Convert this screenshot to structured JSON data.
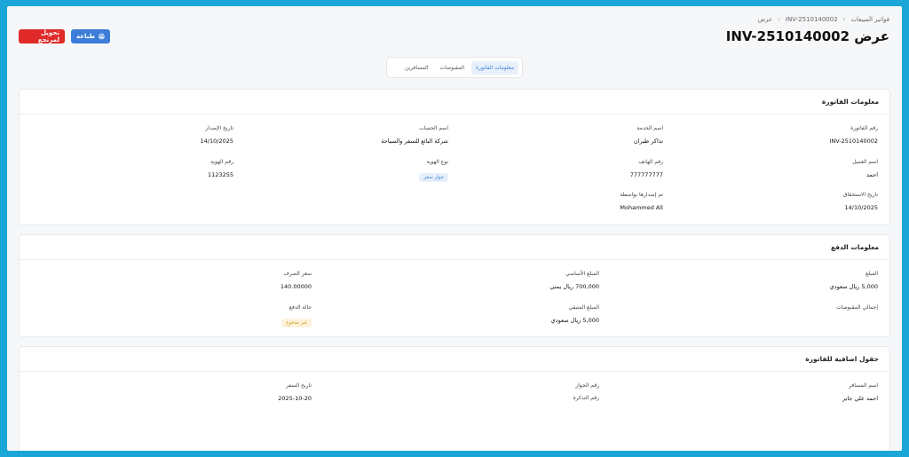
{
  "breadcrumb": {
    "items": [
      "فواتير المبيعات",
      "INV-2510140002",
      "عرض"
    ]
  },
  "page_title": "عرض INV-2510140002",
  "actions": {
    "print_label": "طباعة",
    "convert_label": "تحويل لمرتجع"
  },
  "tabs": [
    "معلومات الفاتورة",
    "المقبوضات",
    "المسافرين"
  ],
  "invoice_info": {
    "heading": "معلومات الفاتورة",
    "invoice_no_label": "رقم الفاتورة",
    "invoice_no": "INV-2510140002",
    "service_label": "اسم الخدمة",
    "service": "تذاكر طيران",
    "account_label": "اسم الحساب",
    "account": "شركة البائع للسفر والسياحة",
    "issue_date_label": "تاريخ الإصدار",
    "issue_date": "14/10/2025",
    "customer_label": "اسم العميل",
    "customer": "احمد",
    "phone_label": "رقم الهاتف",
    "phone": "777777777",
    "id_type_label": "نوع الهوية",
    "id_type": "جواز سفر",
    "id_no_label": "رقم الهوية",
    "id_no": "1123255",
    "due_date_label": "تاريخ الاستحقاق",
    "due_date": "14/10/2025",
    "issued_by_label": "تم إصدارها بواسطة",
    "issued_by": "Mohammed Ali"
  },
  "payment_info": {
    "heading": "معلومات الدفع",
    "amount_label": "المبلغ",
    "amount": "5,000 ريال سعودي",
    "base_amount_label": "المبلغ الأساسي",
    "base_amount": "700,000 ريال يمني",
    "rate_label": "سعر الصرف",
    "rate": "140.00000",
    "received_label": "إجمالي المقبوضات",
    "remaining_label": "المبلغ المتبقي",
    "remaining": "5,000 ريال سعودي",
    "status_label": "حالة الدفع",
    "status": "غير مدفوع"
  },
  "extra_fields": {
    "heading": "حقول اضافية للفاتورة",
    "traveler_label": "اسم المسافر",
    "traveler": "احمد علي جابر",
    "passport_label": "رقم الجواز",
    "ticket_label": "رقم التذكرة",
    "travel_date_label": "تاريخ السفر",
    "travel_date": "2025-10-20"
  },
  "colors": {
    "frame_border": "#1aa6d6",
    "accent_blue": "#3b7dd8",
    "danger_red": "#e02a2a",
    "status_yellow": "#d49b1a"
  }
}
